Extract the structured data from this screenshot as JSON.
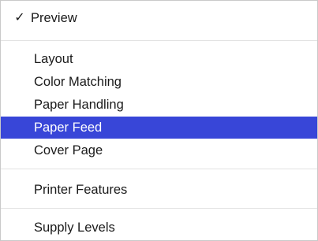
{
  "menu": {
    "items": [
      {
        "label": "Preview",
        "checked": true,
        "check_glyph": "✓"
      },
      {
        "label": "Layout"
      },
      {
        "label": "Color Matching"
      },
      {
        "label": "Paper Handling"
      },
      {
        "label": "Paper Feed",
        "selected": true
      },
      {
        "label": "Cover Page"
      },
      {
        "label": "Printer Features"
      },
      {
        "label": "Supply Levels"
      }
    ]
  },
  "colors": {
    "highlight": "#3846d8",
    "highlight_text": "#ffffff",
    "separator": "#e3e3e3"
  }
}
